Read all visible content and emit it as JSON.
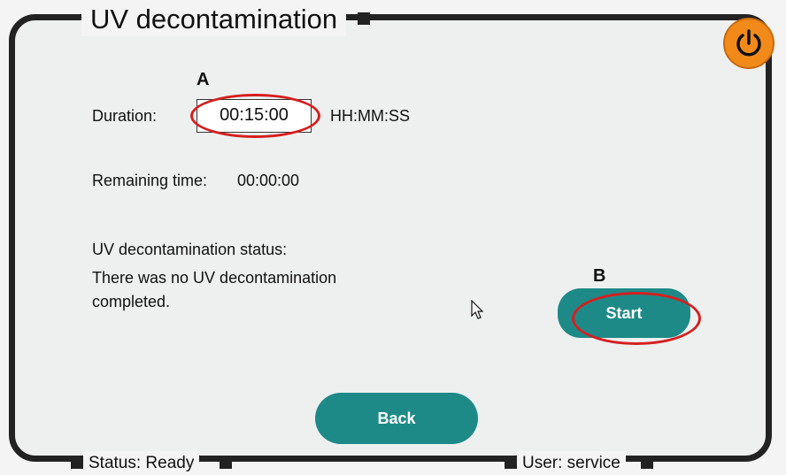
{
  "window": {
    "title": "UV decontamination"
  },
  "markers": {
    "a": "A",
    "b": "B"
  },
  "duration": {
    "label": "Duration:",
    "value": "00:15:00",
    "format": "HH:MM:SS"
  },
  "remaining": {
    "label": "Remaining time:",
    "value": "00:00:00"
  },
  "uv_status": {
    "heading": "UV decontamination status:",
    "line1": "There was no UV decontamination",
    "line2": "completed."
  },
  "buttons": {
    "start": "Start",
    "back": "Back"
  },
  "footer": {
    "status": "Status: Ready",
    "user": "User: service"
  },
  "icons": {
    "power": "power-icon",
    "cursor": "mouse-pointer-icon"
  },
  "colors": {
    "accent": "#1e8a88",
    "power": "#f28a1a",
    "highlight": "#d51f1f"
  }
}
